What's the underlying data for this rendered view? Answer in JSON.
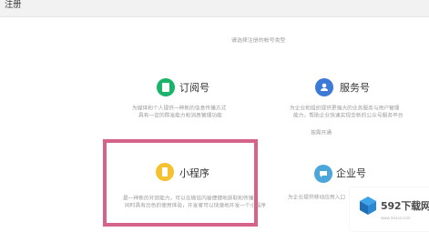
{
  "header": {
    "title": "注册"
  },
  "prompt": {
    "text": "请选择注册的帐号类型"
  },
  "cards": {
    "subscription": {
      "icon": "document-icon",
      "color": "#19b469",
      "title": "订阅号",
      "desc": [
        "为媒体和个人提供一种新的信息传播方式",
        "具有一定的群发能力和消息管理功能"
      ]
    },
    "service": {
      "icon": "user-icon",
      "color": "#3d7ad8",
      "title": "服务号",
      "desc": [
        "为企业和组织提供更强大的业务服务与用户管理",
        "能力，帮助企业快速实现全新的公众号服务平台",
        "按需开通"
      ]
    },
    "miniprogram": {
      "icon": "miniprogram-icon",
      "color": "#f4c12f",
      "title": "小程序",
      "desc": [
        "是一种新的开放能力，可以在微信内被便捷地获取和传播",
        "同时具有出色的使用体验，开发者可以快速地开发一个小程序"
      ]
    },
    "enterprise": {
      "icon": "chat-icon",
      "color": "#4ba7d9",
      "title": "企业号",
      "desc": [
        "为企业提供移动应用入口"
      ]
    }
  },
  "watermark": {
    "text": "592下载网",
    "site": "www.592xz.com"
  }
}
